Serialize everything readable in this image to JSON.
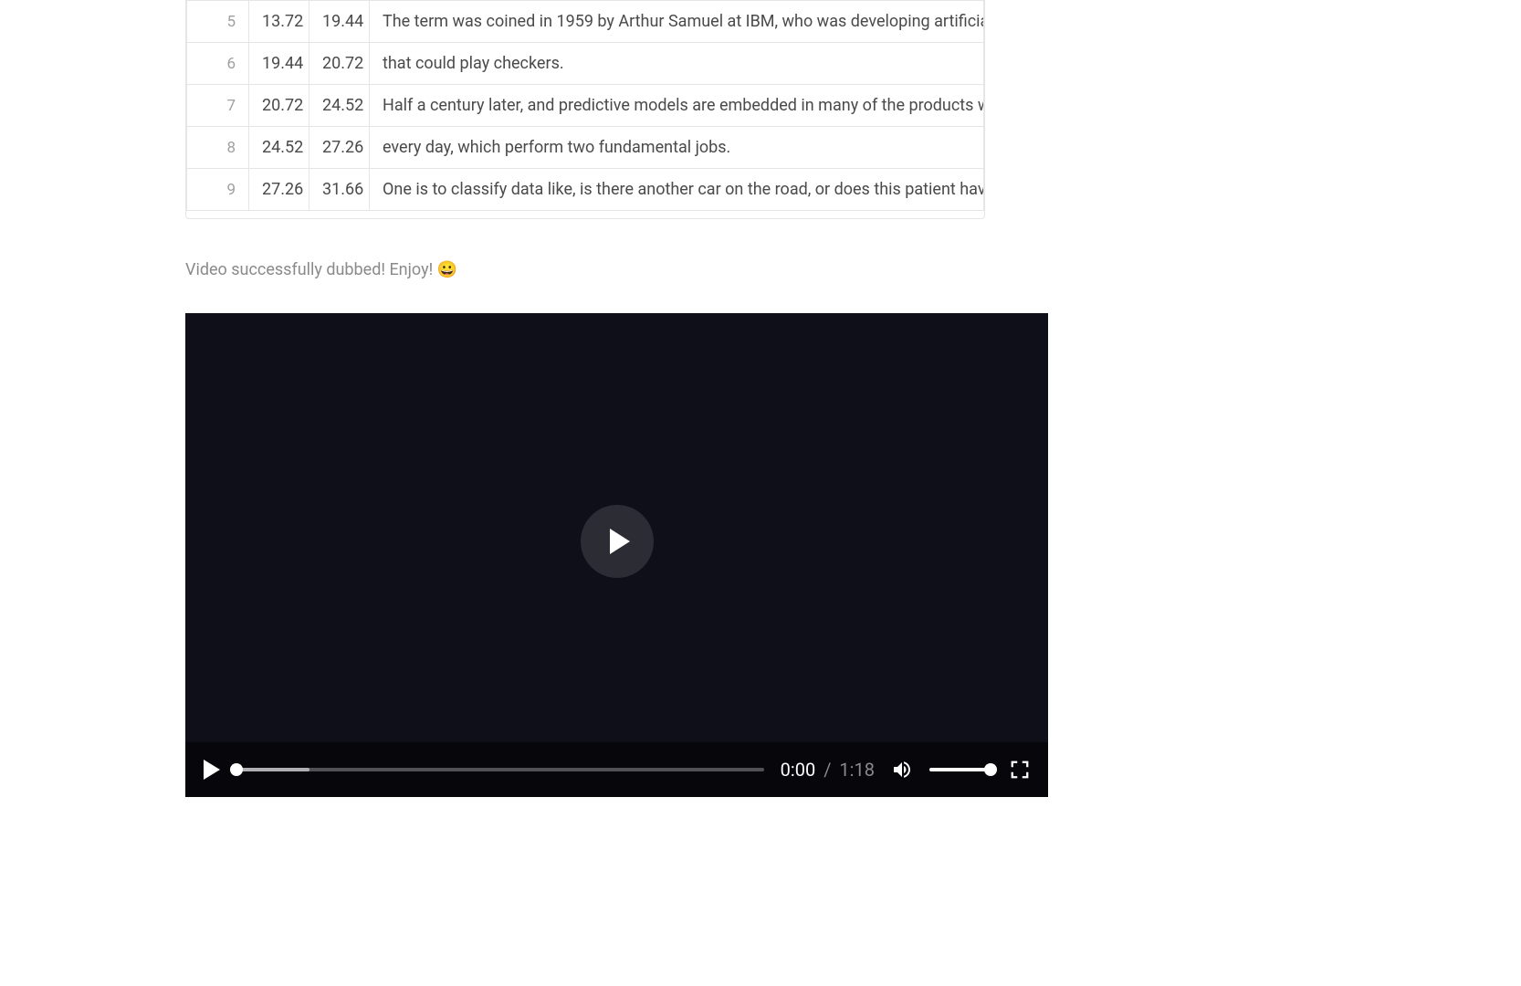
{
  "transcript": {
    "rows": [
      {
        "idx": "5",
        "start": "13.72",
        "end": "19.44",
        "text": "The term was coined in 1959 by Arthur Samuel at IBM, who was developing artificial"
      },
      {
        "idx": "6",
        "start": "19.44",
        "end": "20.72",
        "text": "that could play checkers."
      },
      {
        "idx": "7",
        "start": "20.72",
        "end": "24.52",
        "text": "Half a century later, and predictive models are embedded in many of the products w"
      },
      {
        "idx": "8",
        "start": "24.52",
        "end": "27.26",
        "text": "every day, which perform two fundamental jobs."
      },
      {
        "idx": "9",
        "start": "27.26",
        "end": "31.66",
        "text": "One is to classify data like, is there another car on the road, or does this patient have"
      }
    ]
  },
  "status_message": "Video successfully dubbed! Enjoy! 😀",
  "player": {
    "current_time": "0:00",
    "separator": "/",
    "duration": "1:18"
  }
}
